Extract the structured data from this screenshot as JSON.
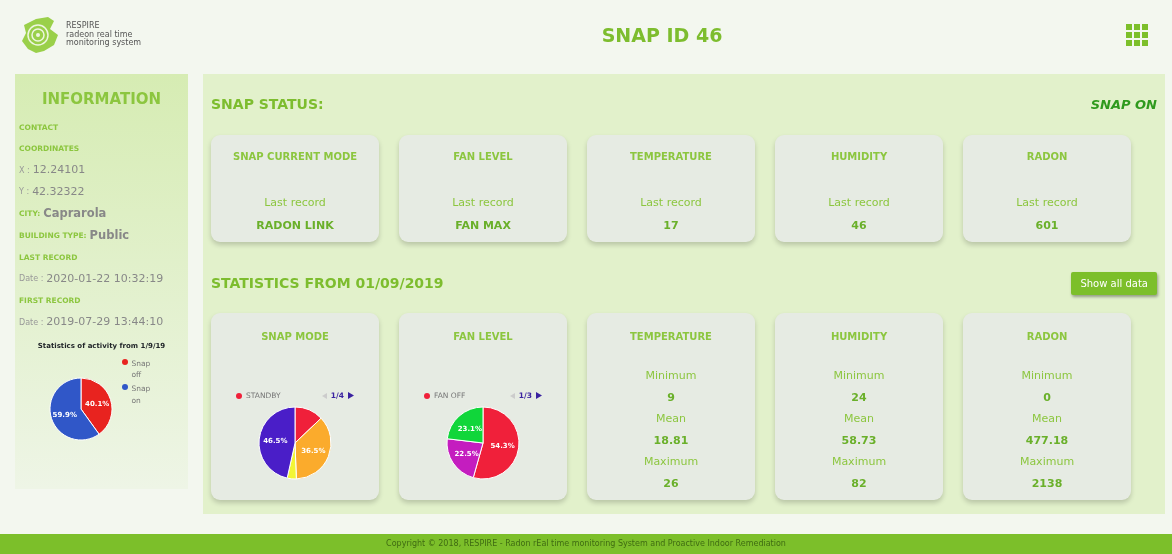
{
  "header": {
    "logo_lines": [
      "RESPIRE",
      "radeon real time",
      "monitoring system"
    ],
    "title": "SNAP ID 46"
  },
  "sidebar": {
    "title": "INFORMATION",
    "fields": [
      {
        "kind": "heading",
        "label": "CONTACT"
      },
      {
        "kind": "heading",
        "label": "COORDINATES"
      },
      {
        "kind": "plain",
        "label": "X :",
        "value": "12.24101"
      },
      {
        "kind": "plain",
        "label": "Y :",
        "value": "42.32322"
      },
      {
        "kind": "strong",
        "label": "CITY:",
        "value": "Caprarola"
      },
      {
        "kind": "strong",
        "label": "BUILDING TYPE:",
        "value": "Public"
      },
      {
        "kind": "heading",
        "label": "LAST RECORD"
      },
      {
        "kind": "plain",
        "label": "Date :",
        "value": "2020-01-22 10:32:19"
      },
      {
        "kind": "heading",
        "label": "FIRST RECORD"
      },
      {
        "kind": "plain",
        "label": "Date :",
        "value": "2019-07-29 13:44:10"
      }
    ],
    "chart_data": {
      "type": "pie",
      "title": "Statistics of activity from 1/9/19",
      "categories": [
        "Snap off",
        "Snap on"
      ],
      "values": [
        40.1,
        59.9
      ],
      "legend": "right",
      "colors": [
        "#e8231f",
        "#3057c8"
      ],
      "value_labels": [
        "40.1%",
        "59.9%"
      ]
    }
  },
  "status": {
    "title": "SNAP STATUS:",
    "state": "SNAP ON",
    "cards": [
      {
        "title": "SNAP CURRENT MODE",
        "caption": "Last record",
        "value": "RADON LINK"
      },
      {
        "title": "FAN LEVEL",
        "caption": "Last record",
        "value": "FAN MAX"
      },
      {
        "title": "TEMPERATURE",
        "caption": "Last record",
        "value": "17"
      },
      {
        "title": "HUMIDITY",
        "caption": "Last record",
        "value": "46"
      },
      {
        "title": "RADON",
        "caption": "Last record",
        "value": "601"
      }
    ]
  },
  "statistics": {
    "title": "STATISTICS FROM 01/09/2019",
    "button": "Show all data",
    "cards": [
      {
        "kind": "pie",
        "title": "SNAP MODE",
        "legend": {
          "label": "STANDBY",
          "color": "#f0203a",
          "page": "1/4"
        },
        "chart_data": {
          "type": "pie",
          "values": [
            12.9,
            36.5,
            4.1,
            46.5
          ],
          "colors": [
            "#f0203a",
            "#fbab2c",
            "#f2f535",
            "#4a1ec8"
          ],
          "value_labels": [
            null,
            "36.5%",
            null,
            "46.5%"
          ]
        }
      },
      {
        "kind": "pie",
        "title": "FAN LEVEL",
        "legend": {
          "label": "FAN OFF",
          "color": "#f0203a",
          "page": "1/3"
        },
        "chart_data": {
          "type": "pie",
          "values": [
            54.3,
            22.5,
            23.1
          ],
          "colors": [
            "#f0203a",
            "#c41dbf",
            "#10d63a"
          ],
          "value_labels": [
            "54.3%",
            "22.5%",
            "23.1%"
          ]
        }
      },
      {
        "kind": "minmax",
        "title": "TEMPERATURE",
        "rows": [
          {
            "label": "Minimum",
            "value": "9"
          },
          {
            "label": "Mean",
            "value": "18.81"
          },
          {
            "label": "Maximum",
            "value": "26"
          }
        ]
      },
      {
        "kind": "minmax",
        "title": "HUMIDITY",
        "rows": [
          {
            "label": "Minimum",
            "value": "24"
          },
          {
            "label": "Mean",
            "value": "58.73"
          },
          {
            "label": "Maximum",
            "value": "82"
          }
        ]
      },
      {
        "kind": "minmax",
        "title": "RADON",
        "rows": [
          {
            "label": "Minimum",
            "value": "0"
          },
          {
            "label": "Mean",
            "value": "477.18"
          },
          {
            "label": "Maximum",
            "value": "2138"
          }
        ]
      }
    ]
  },
  "footer": "Copyright © 2018, RESPIRE - Radon rEal time monitoring System and Proactive Indoor Remediation"
}
